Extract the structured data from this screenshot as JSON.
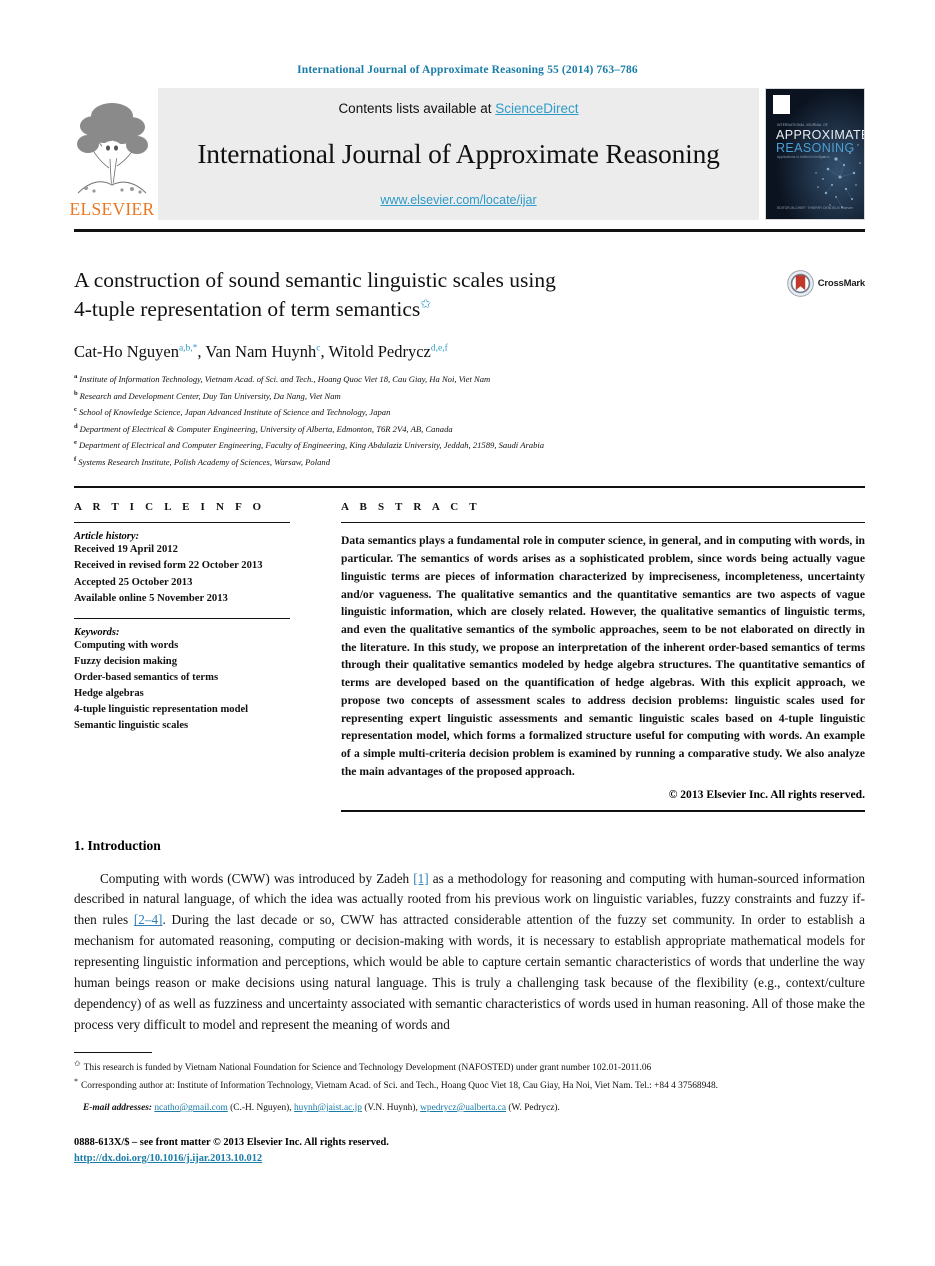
{
  "running_head": "International Journal of Approximate Reasoning 55 (2014) 763–786",
  "masthead": {
    "publisher_name": "ELSEVIER",
    "contents_prefix": "Contents lists available at ",
    "sciencedirect": "ScienceDirect",
    "journal_title": "International Journal of Approximate Reasoning",
    "journal_url": "www.elsevier.com/locate/ijar",
    "cover": {
      "line1": "APPROXIMATE",
      "line2": "REASONING",
      "top_tiny": "INTERNATIONAL JOURNAL OF",
      "subtitle": "Applications in Artificial Intelligence",
      "footer": "EDITOR-IN-CHIEF: THIERRY DENOEUX\nElsevier"
    },
    "link_color": "#2e9bc9",
    "brand_color": "#e87722"
  },
  "article": {
    "title_line1": "A construction of sound semantic linguistic scales using",
    "title_line2": "4-tuple representation of term semantics",
    "title_footnote_mark": "✩",
    "crossmark_label": "CrossMark",
    "authors": [
      {
        "name": "Cat-Ho Nguyen",
        "sups": "a,b,",
        "star": "*"
      },
      {
        "name": "Van Nam Huynh",
        "sups": "c",
        "star": ""
      },
      {
        "name": "Witold Pedrycz",
        "sups": "d,e,f",
        "star": ""
      }
    ],
    "affiliations": [
      {
        "mark": "a",
        "text": "Institute of Information Technology, Vietnam Acad. of Sci. and Tech., Hoang Quoc Viet 18, Cau Giay, Ha Noi, Viet Nam"
      },
      {
        "mark": "b",
        "text": "Research and Development Center, Duy Tan University, Da Nang, Viet Nam"
      },
      {
        "mark": "c",
        "text": "School of Knowledge Science, Japan Advanced Institute of Science and Technology, Japan"
      },
      {
        "mark": "d",
        "text": "Department of Electrical & Computer Engineering, University of Alberta, Edmonton, T6R 2V4, AB, Canada"
      },
      {
        "mark": "e",
        "text": "Department of Electrical and Computer Engineering, Faculty of Engineering, King Abdulaziz University, Jeddah, 21589, Saudi Arabia"
      },
      {
        "mark": "f",
        "text": "Systems Research Institute, Polish Academy of Sciences, Warsaw, Poland"
      }
    ]
  },
  "info": {
    "heading": "A R T I C L E    I N F O",
    "history_label": "Article history:",
    "history": [
      "Received 19 April 2012",
      "Received in revised form 22 October 2013",
      "Accepted 25 October 2013",
      "Available online 5 November 2013"
    ],
    "keywords_label": "Keywords:",
    "keywords": [
      "Computing with words",
      "Fuzzy decision making",
      "Order-based semantics of terms",
      "Hedge algebras",
      "4-tuple linguistic representation model",
      "Semantic linguistic scales"
    ]
  },
  "abstract": {
    "heading": "A B S T R A C T",
    "text": "Data semantics plays a fundamental role in computer science, in general, and in computing with words, in particular. The semantics of words arises as a sophisticated problem, since words being actually vague linguistic terms are pieces of information characterized by impreciseness, incompleteness, uncertainty and/or vagueness. The qualitative semantics and the quantitative semantics are two aspects of vague linguistic information, which are closely related. However, the qualitative semantics of linguistic terms, and even the qualitative semantics of the symbolic approaches, seem to be not elaborated on directly in the literature. In this study, we propose an interpretation of the inherent order-based semantics of terms through their qualitative semantics modeled by hedge algebra structures. The quantitative semantics of terms are developed based on the quantification of hedge algebras. With this explicit approach, we propose two concepts of assessment scales to address decision problems: linguistic scales used for representing expert linguistic assessments and semantic linguistic scales based on 4-tuple linguistic representation model, which forms a formalized structure useful for computing with words. An example of a simple multi-criteria decision problem is examined by running a comparative study. We also analyze the main advantages of the proposed approach.",
    "copyright": "© 2013 Elsevier Inc. All rights reserved."
  },
  "body": {
    "section_number_title": "1.  Introduction",
    "paragraph_1_a": "Computing with words (CWW) was introduced by Zadeh ",
    "ref_1": "[1]",
    "paragraph_1_b": " as a methodology for reasoning and computing with human-sourced information described in natural language, of which the idea was actually rooted from his previous work on linguistic variables, fuzzy constraints and fuzzy if-then rules ",
    "ref_2": "[2–4]",
    "paragraph_1_c": ". During the last decade or so, CWW has attracted considerable attention of the fuzzy set community. In order to establish a mechanism for automated reasoning, computing or decision-making with words, it is necessary to establish appropriate mathematical models for representing linguistic information and perceptions, which would be able to capture certain semantic characteristics of words that underline the way human beings reason or make decisions using natural language. This is truly a challenging task because of the flexibility (e.g., context/culture dependency) of as well as fuzziness and uncertainty associated with semantic characteristics of words used in human reasoning. All of those make the process very difficult to model and represent the meaning of words and"
  },
  "footnotes": {
    "funding_mark": "✩",
    "funding": "This research is funded by Vietnam National Foundation for Science and Technology Development (NAFOSTED) under grant number 102.01-2011.06",
    "corresponding_mark": "*",
    "corresponding": "Corresponding author at: Institute of Information Technology, Vietnam Acad. of Sci. and Tech., Hoang Quoc Viet 18, Cau Giay, Ha Noi, Viet Nam. Tel.: +84 4 37568948.",
    "email_label": "E-mail addresses:",
    "emails": [
      {
        "address": "ncatho@gmail.com",
        "who": " (C.-H. Nguyen), "
      },
      {
        "address": "huynh@jaist.ac.jp",
        "who": " (V.N. Huynh), "
      },
      {
        "address": "wpedrycz@ualberta.ca",
        "who": " (W. Pedrycz)."
      }
    ]
  },
  "imprint": {
    "issn_line": "0888-613X/$ – see front matter  © 2013 Elsevier Inc. All rights reserved.",
    "doi": "http://dx.doi.org/10.1016/j.ijar.2013.10.012"
  }
}
